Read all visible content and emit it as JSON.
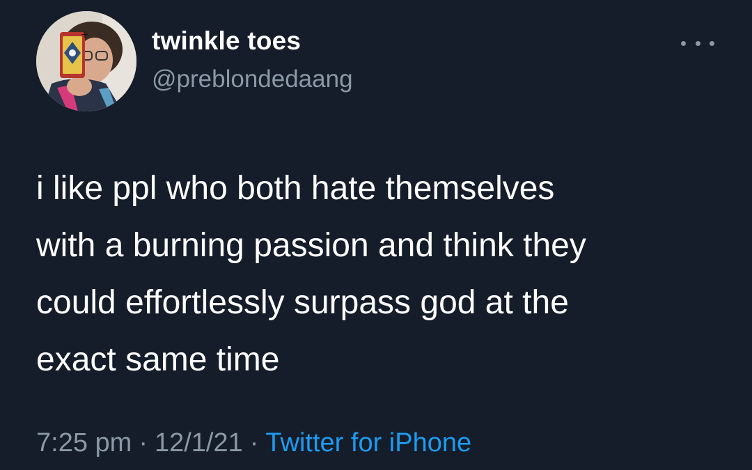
{
  "author": {
    "display_name": "twinkle toes",
    "handle": "@preblondedaang"
  },
  "tweet": {
    "lines": [
      "i like ppl who both hate themselves",
      "with a burning passion and think they",
      "could effortlessly surpass god at the",
      "exact same time"
    ]
  },
  "meta": {
    "time": "7:25 pm",
    "separator": "·",
    "date": "12/1/21",
    "source": "Twitter for iPhone"
  },
  "icons": {
    "more": "more-options-icon",
    "avatar": "avatar"
  },
  "colors": {
    "background": "#151d2a",
    "text": "#ffffff",
    "secondary_text": "#8b98a5",
    "link": "#1d9bf0"
  }
}
